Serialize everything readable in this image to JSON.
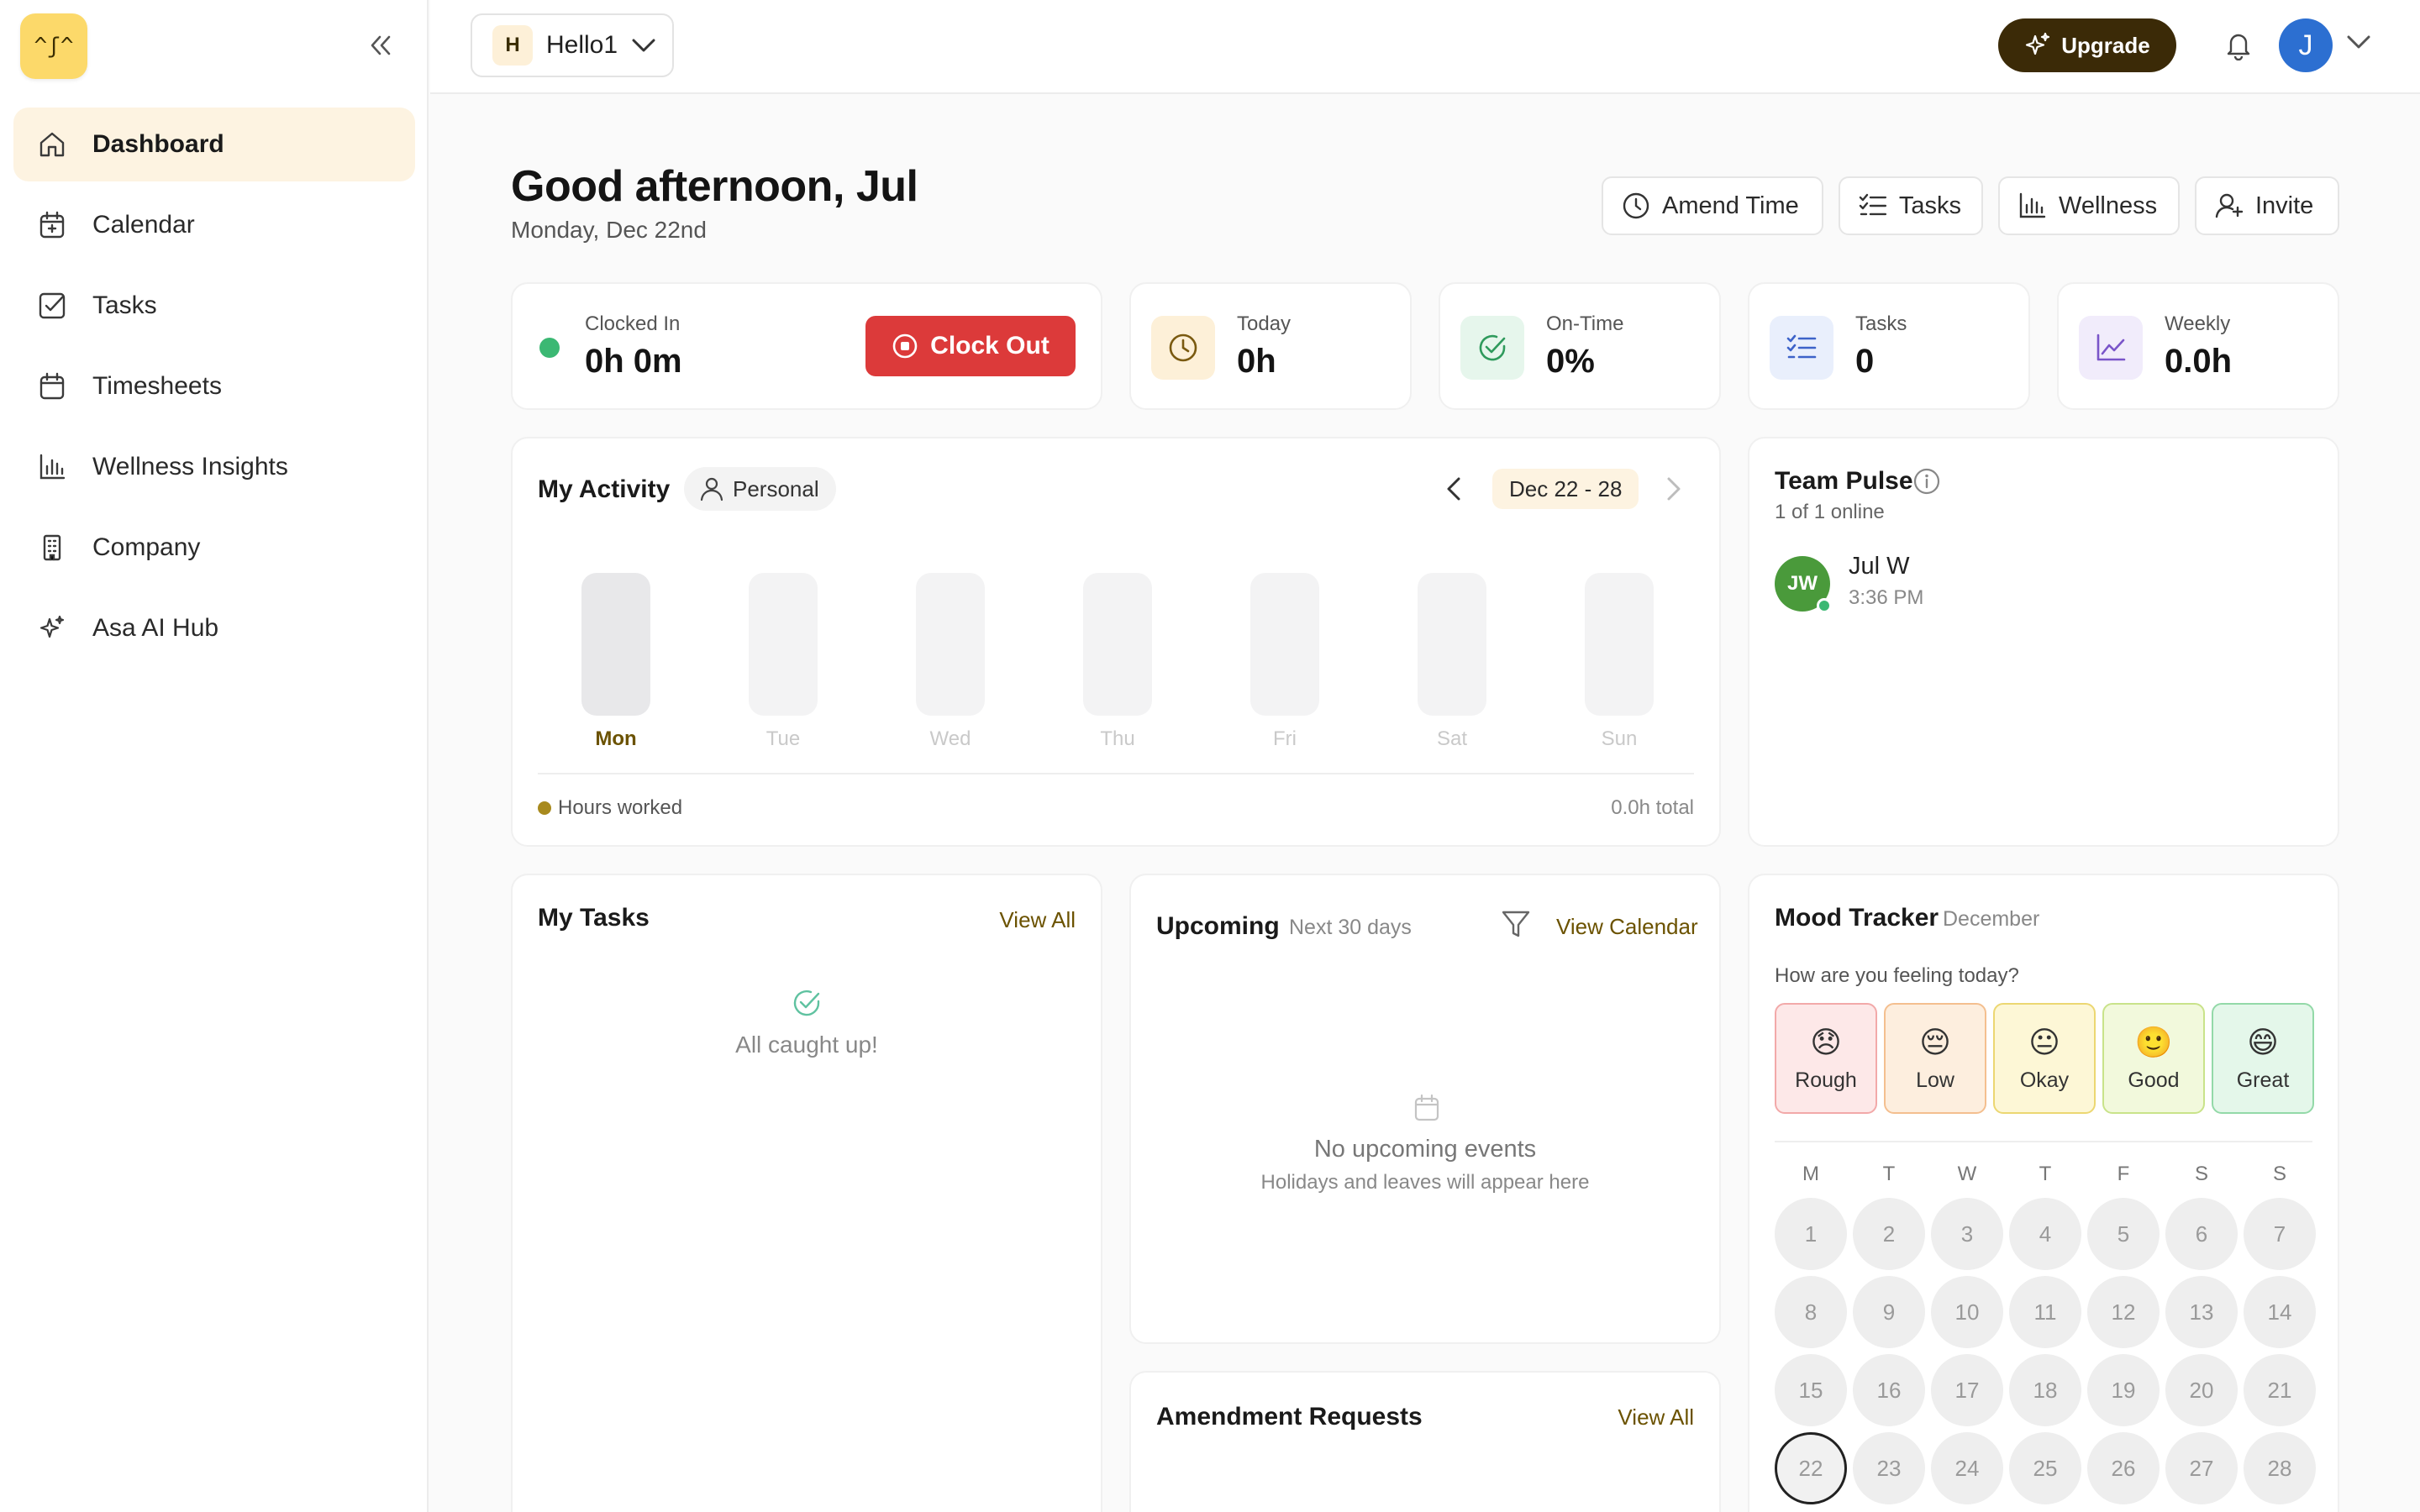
{
  "brand": {
    "logo_glyph": "^ʃ^"
  },
  "sidebar": {
    "items": [
      {
        "label": "Dashboard",
        "icon": "home-icon",
        "active": true
      },
      {
        "label": "Calendar",
        "icon": "calendar-icon"
      },
      {
        "label": "Tasks",
        "icon": "checkbox-icon"
      },
      {
        "label": "Timesheets",
        "icon": "calendar-sheet-icon"
      },
      {
        "label": "Wellness Insights",
        "icon": "bar-chart-icon"
      },
      {
        "label": "Company",
        "icon": "building-icon"
      },
      {
        "label": "Asa AI Hub",
        "icon": "sparkles-icon"
      }
    ]
  },
  "topbar": {
    "workspace_initial": "H",
    "workspace_name": "Hello1",
    "upgrade_label": "Upgrade",
    "user_initial": "J"
  },
  "greeting": {
    "title": "Good afternoon, Jul",
    "date": "Monday, Dec 22nd"
  },
  "quick_actions": {
    "amend": "Amend Time",
    "tasks": "Tasks",
    "wellness": "Wellness",
    "invite": "Invite"
  },
  "stats": {
    "clocked_in_label": "Clocked In",
    "clocked_in_value": "0h 0m",
    "clock_out_label": "Clock Out",
    "today_label": "Today",
    "today_value": "0h",
    "ontime_label": "On-Time",
    "ontime_value": "0%",
    "tasks_label": "Tasks",
    "tasks_value": "0",
    "weekly_label": "Weekly",
    "weekly_value": "0.0h"
  },
  "activity": {
    "title": "My Activity",
    "scope": "Personal",
    "range": "Dec 22 - 28",
    "days": [
      "Mon",
      "Tue",
      "Wed",
      "Thu",
      "Fri",
      "Sat",
      "Sun"
    ],
    "legend": "Hours worked",
    "total": "0.0h total"
  },
  "team": {
    "title": "Team Pulse",
    "online": "1 of 1 online",
    "member_initials": "JW",
    "member_name": "Jul W",
    "member_time": "3:36 PM"
  },
  "my_tasks": {
    "title": "My Tasks",
    "view_all": "View All",
    "empty": "All caught up!"
  },
  "upcoming": {
    "title": "Upcoming",
    "subtitle": "Next 30 days",
    "view_calendar": "View Calendar",
    "empty_title": "No upcoming events",
    "empty_sub": "Holidays and leaves will appear here"
  },
  "amendments": {
    "title": "Amendment Requests",
    "view_all": "View All"
  },
  "mood": {
    "title": "Mood Tracker",
    "month": "December",
    "question": "How are you feeling today?",
    "options": [
      {
        "label": "Rough",
        "emoji": "😞",
        "bg": "#fde8e8",
        "border": "#f2a9a9"
      },
      {
        "label": "Low",
        "emoji": "😔",
        "bg": "#fdeede",
        "border": "#f4bf8f"
      },
      {
        "label": "Okay",
        "emoji": "😐",
        "bg": "#fdf7d6",
        "border": "#ecd772"
      },
      {
        "label": "Good",
        "emoji": "🙂",
        "bg": "#f2f9dc",
        "border": "#c9e38a"
      },
      {
        "label": "Great",
        "emoji": "😄",
        "bg": "#e4f7ea",
        "border": "#93d9a8"
      }
    ],
    "weekdays": [
      "M",
      "T",
      "W",
      "T",
      "F",
      "S",
      "S"
    ],
    "days": [
      "1",
      "2",
      "3",
      "4",
      "5",
      "6",
      "7",
      "8",
      "9",
      "10",
      "11",
      "12",
      "13",
      "14",
      "15",
      "16",
      "17",
      "18",
      "19",
      "20",
      "21",
      "22",
      "23",
      "24",
      "25",
      "26",
      "27",
      "28"
    ],
    "today": "22"
  },
  "colors": {
    "accent": "#3b2a07",
    "danger": "#dc3a3a",
    "online": "#3bb873",
    "legend_dot": "#a88a1e"
  }
}
